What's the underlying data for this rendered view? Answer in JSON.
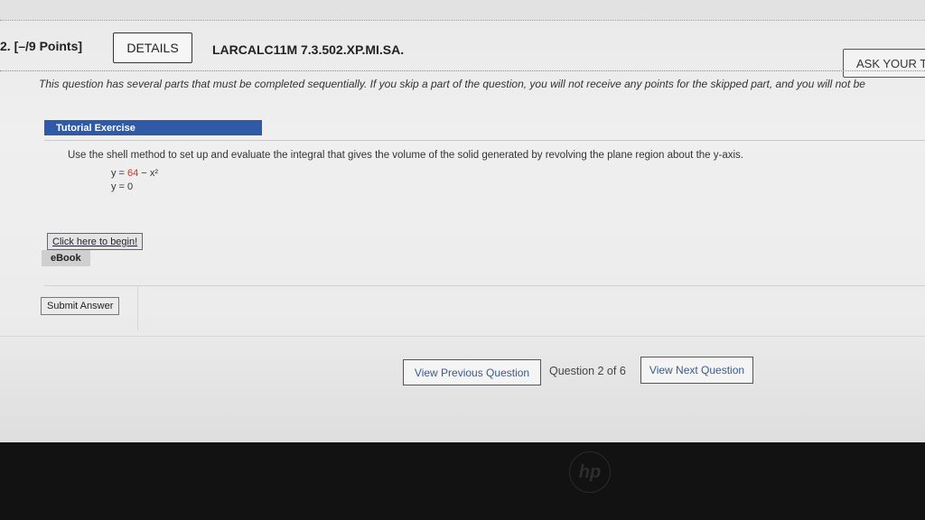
{
  "question": {
    "number_points": "2. [–/9 Points]",
    "details_label": "DETAILS",
    "code": "LARCALC11M 7.3.502.XP.MI.SA.",
    "ask_label": "ASK YOUR TE"
  },
  "notice": "This question has several parts that must be completed sequentially. If you skip a part of the question, you will not receive any points for the skipped part, and you will not be",
  "tutorial": {
    "heading": "Tutorial Exercise",
    "prompt": "Use the shell method to set up and evaluate the integral that gives the volume of the solid generated by revolving the plane region about the y-axis.",
    "eq1_lhs": "y = ",
    "eq1_const": "64",
    "eq1_rest": " − x²",
    "eq2": "y = 0",
    "begin_label": "Click here to begin!",
    "ebook_label": "eBook"
  },
  "submit_label": "Submit Answer",
  "navigation": {
    "prev_label": "View Previous Question",
    "count_label": "Question 2 of 6",
    "next_label": "View Next Question"
  },
  "colors": {
    "tutorial_bar": "#2e5aa8",
    "link_text": "#3a5a8c",
    "equation_constant": "#c0392b"
  },
  "icons": {
    "bezel_logo": "hp-logo-icon"
  }
}
